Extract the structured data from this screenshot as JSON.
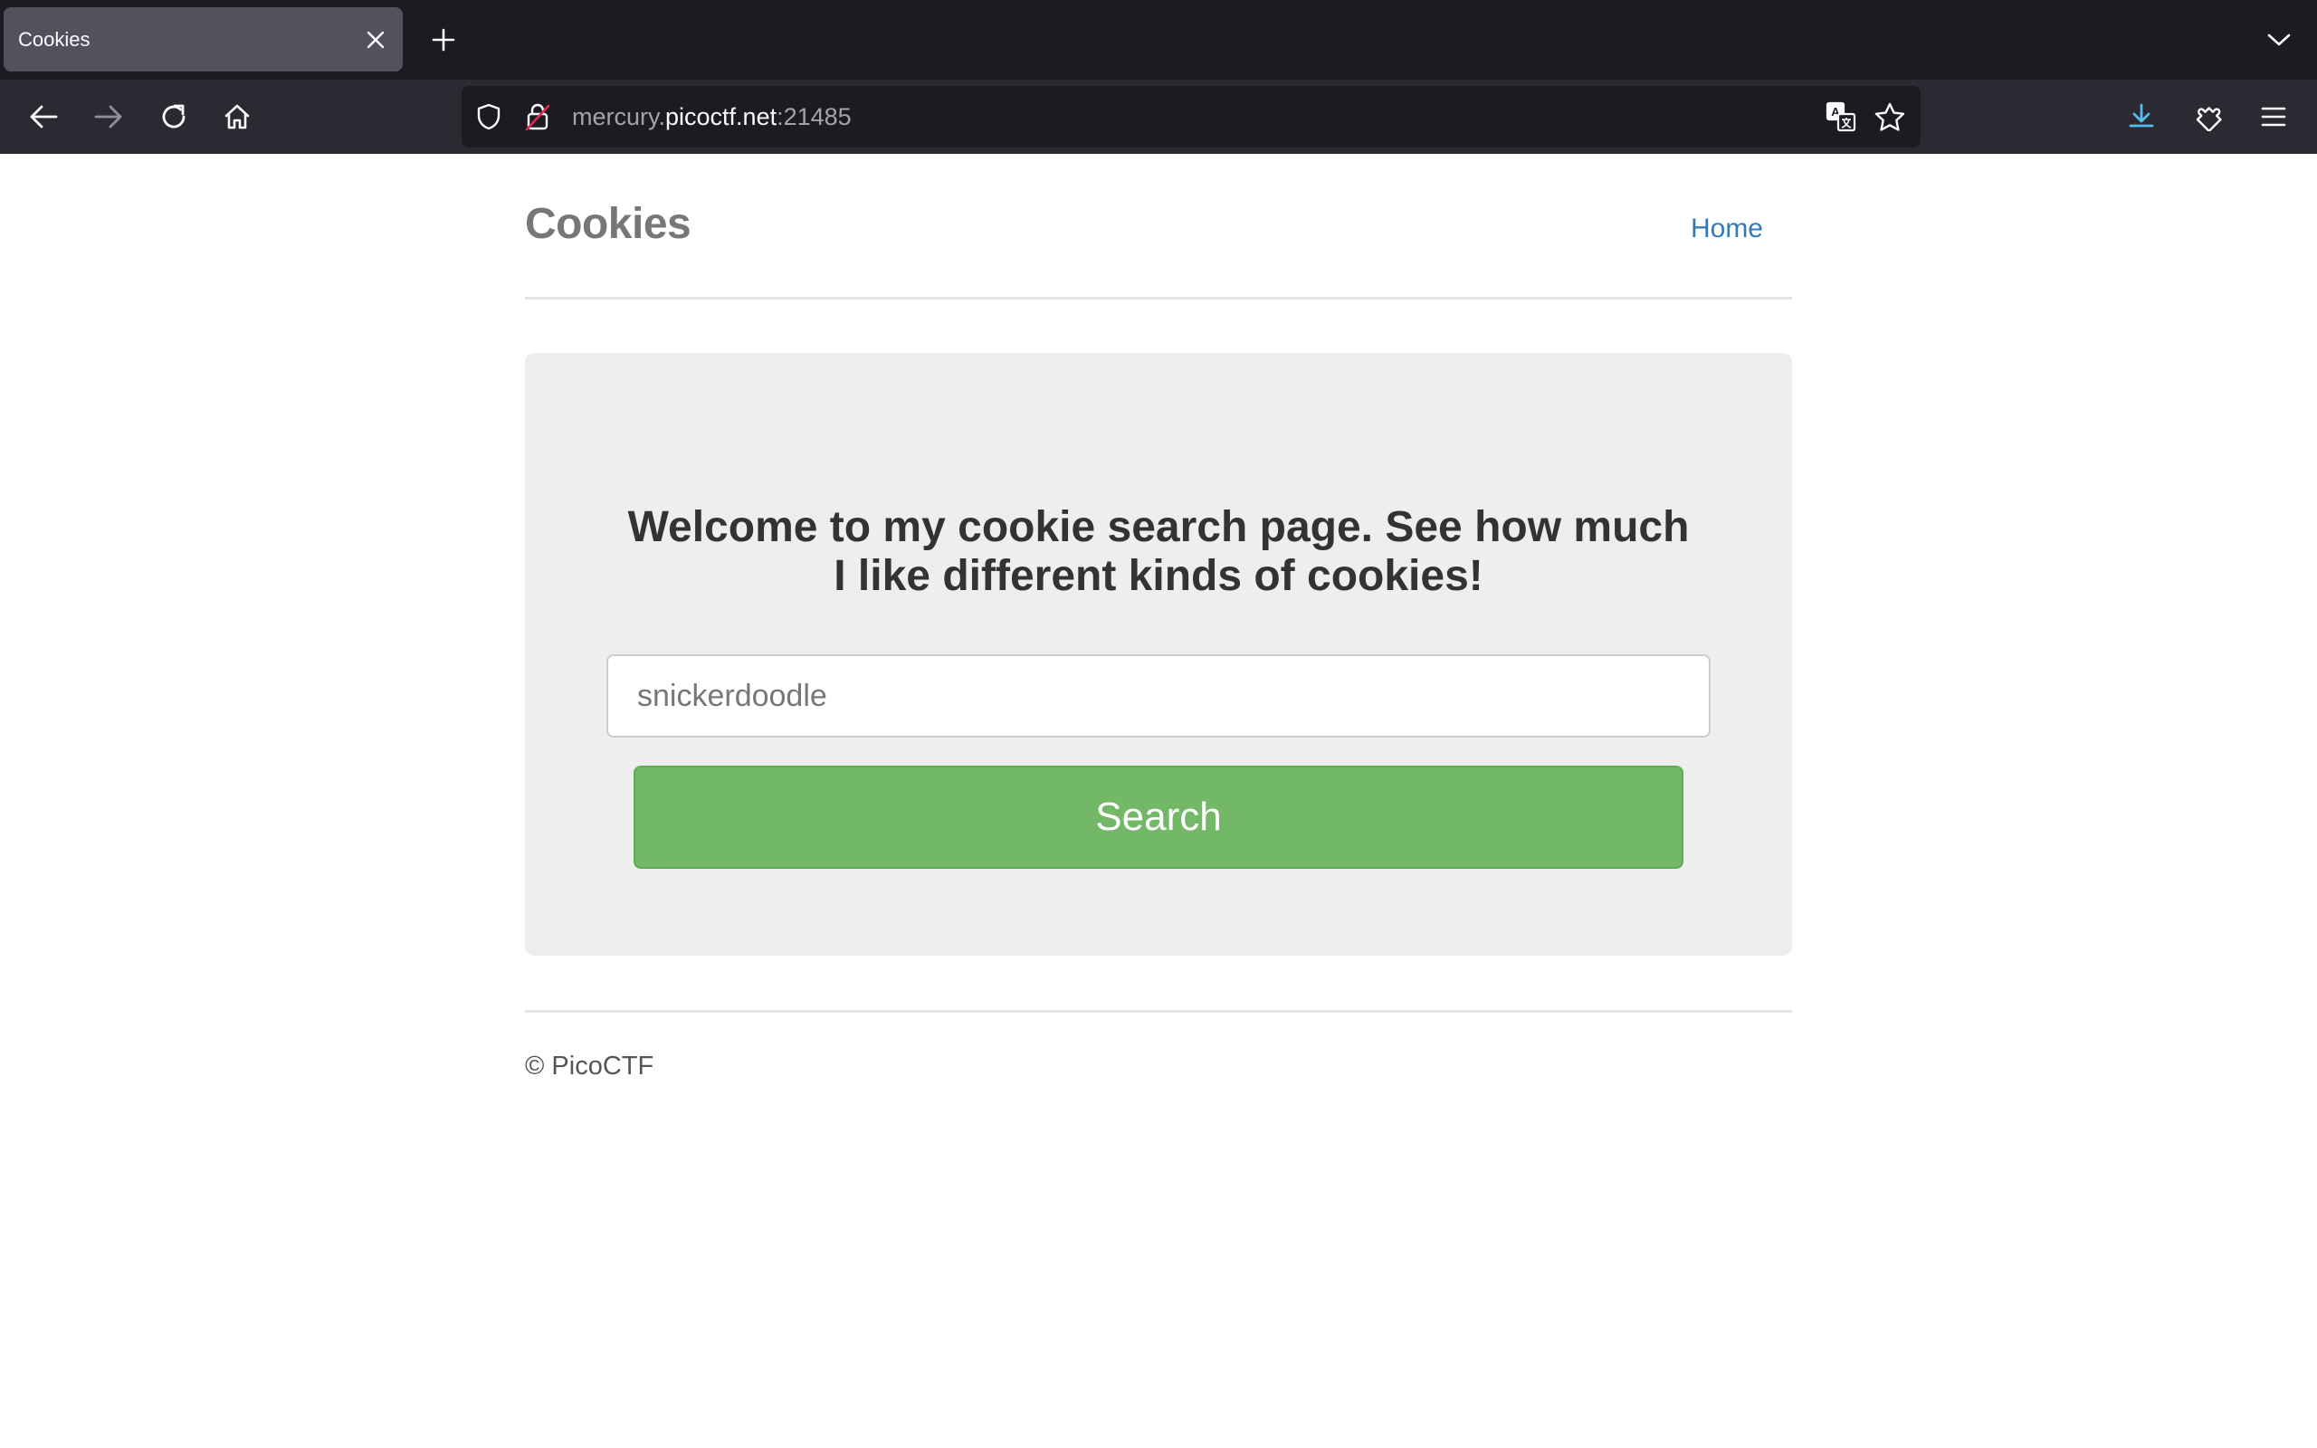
{
  "browser": {
    "tab": {
      "title": "Cookies"
    },
    "url": {
      "prefix": "mercury.",
      "domain": "picoctf.net",
      "suffix": ":21485"
    }
  },
  "site": {
    "title": "Cookies",
    "nav": {
      "home_label": "Home"
    }
  },
  "main": {
    "welcome": "Welcome to my cookie search page. See how much I like different kinds of cookies!",
    "search": {
      "placeholder": "snickerdoodle",
      "value": ""
    },
    "search_button_label": "Search"
  },
  "footer": {
    "text": "© PicoCTF"
  },
  "colors": {
    "search_button": "#72b866",
    "link": "#337ab7",
    "jumbotron_bg": "#eeeeee",
    "chrome_dark": "#1c1b22",
    "chrome_nav": "#2b2a33"
  }
}
